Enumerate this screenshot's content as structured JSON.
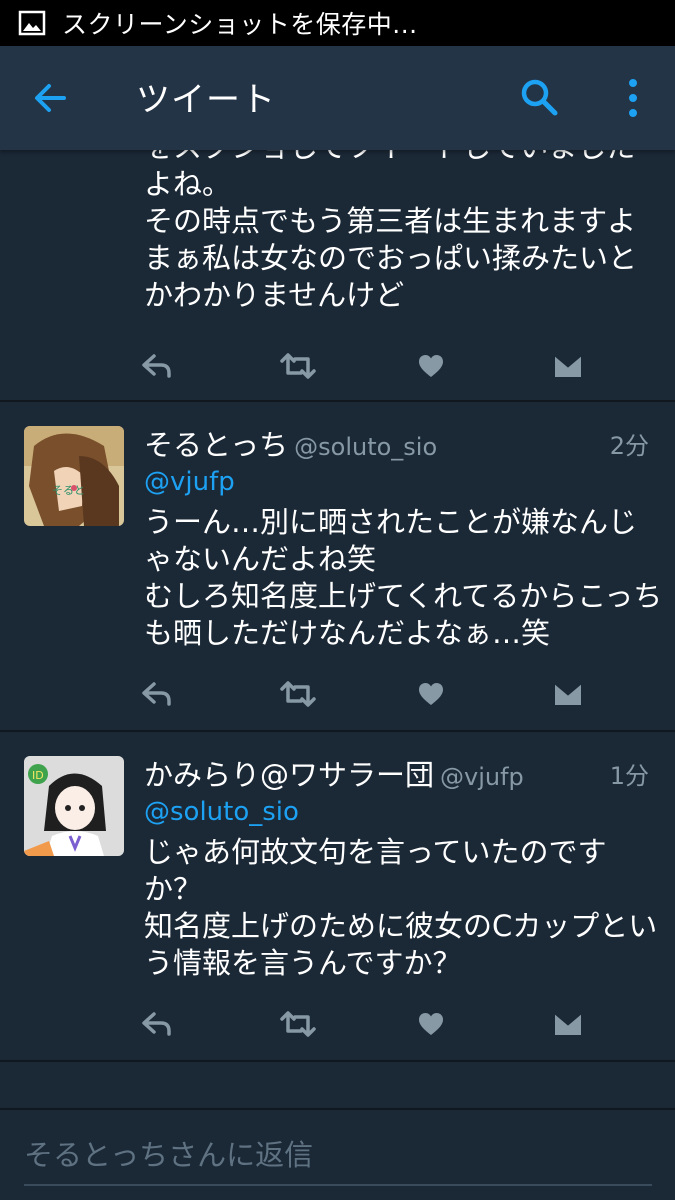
{
  "status_bar": {
    "icon": "image-icon",
    "text": "スクリーンショットを保存中..."
  },
  "app_bar": {
    "title": "ツイート",
    "back_icon": "arrow-left-icon",
    "search_icon": "search-icon",
    "more_icon": "more-vertical-icon"
  },
  "tweets": [
    {
      "text": "をスクショしてツイートしていましたよね。\nその時点でもう第三者は生まれますよ\nまぁ私は女なのでおっぱい揉みたいとかわかりませんけど"
    },
    {
      "name": "そるとっち",
      "handle": "@soluto_sio",
      "time": "2分",
      "mention": "@vjufp",
      "text": "うーん…別に晒されたことが嫌なんじゃないんだよね笑\nむしろ知名度上げてくれてるからこっちも晒しただけなんだよなぁ…笑"
    },
    {
      "name": "かみらり@ワサラー団",
      "handle": "@vjufp",
      "time": "1分",
      "mention": "@soluto_sio",
      "text": "じゃあ何故文句を言っていたのですか？\n知名度上げのために彼女のCカップという情報を言うんですか？"
    }
  ],
  "reply": {
    "placeholder": "そるとっちさんに返信"
  },
  "colors": {
    "background": "#1b2836",
    "app_bar": "#243447",
    "accent": "#1da1f2",
    "secondary_text": "#8899a6"
  }
}
